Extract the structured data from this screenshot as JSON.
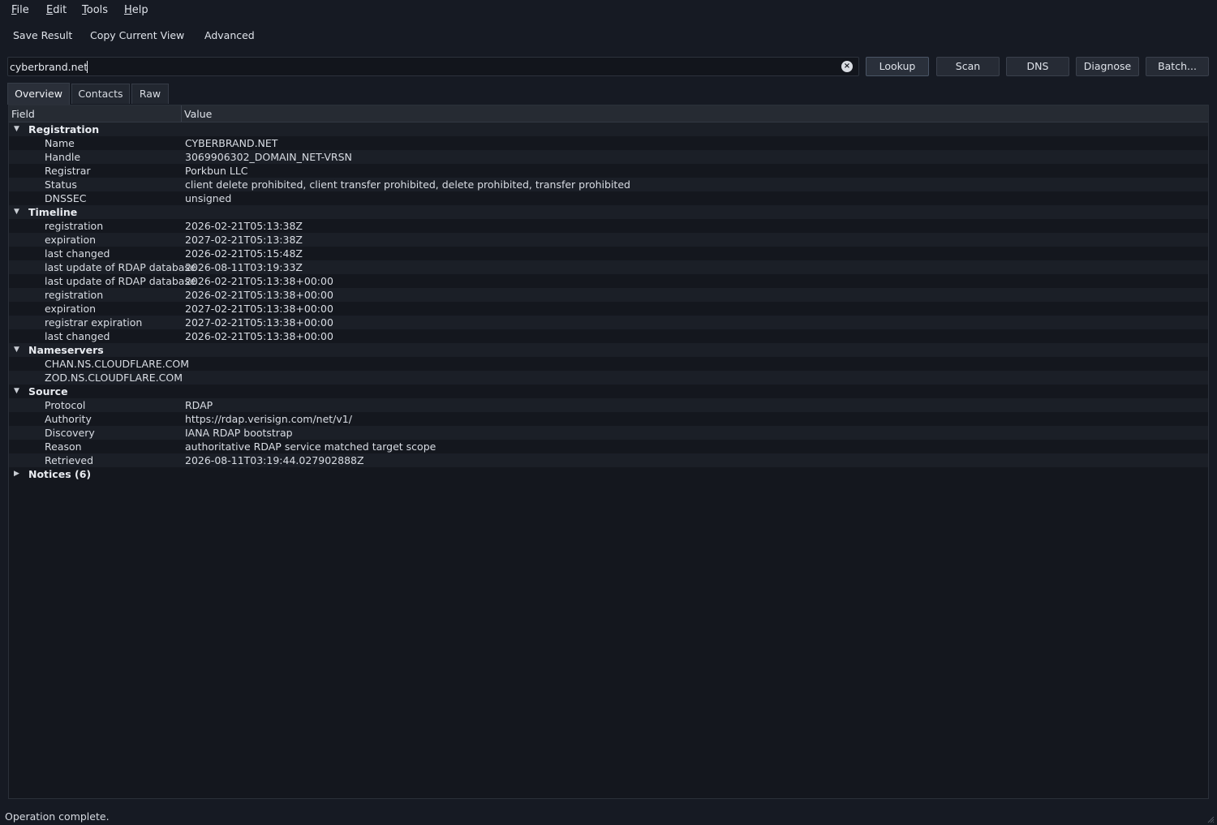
{
  "menubar": {
    "items": [
      {
        "label": "File",
        "mnemonic": "F",
        "rest": "ile"
      },
      {
        "label": "Edit",
        "mnemonic": "E",
        "rest": "dit"
      },
      {
        "label": "Tools",
        "mnemonic": "T",
        "rest": "ools"
      },
      {
        "label": "Help",
        "mnemonic": "H",
        "rest": "elp"
      }
    ]
  },
  "toolbar": {
    "save_result": "Save Result",
    "copy_current_view": "Copy Current View",
    "advanced": "Advanced"
  },
  "search": {
    "value": "cyberbrand.net",
    "clear_icon": "×"
  },
  "actions": {
    "lookup": "Lookup",
    "scan": "Scan",
    "dns": "DNS",
    "diagnose": "Diagnose",
    "batch": "Batch..."
  },
  "tabs": {
    "overview": "Overview",
    "contacts": "Contacts",
    "raw": "Raw"
  },
  "tree": {
    "header": {
      "field": "Field",
      "value": "Value"
    },
    "groups": {
      "registration": {
        "label": "Registration",
        "rows": [
          {
            "field": "Name",
            "value": "CYBERBRAND.NET"
          },
          {
            "field": "Handle",
            "value": "3069906302_DOMAIN_NET-VRSN"
          },
          {
            "field": "Registrar",
            "value": "Porkbun LLC"
          },
          {
            "field": "Status",
            "value": "client delete prohibited, client transfer prohibited, delete prohibited, transfer prohibited"
          },
          {
            "field": "DNSSEC",
            "value": "unsigned"
          }
        ]
      },
      "timeline": {
        "label": "Timeline",
        "rows": [
          {
            "field": "registration",
            "value": "2026-02-21T05:13:38Z"
          },
          {
            "field": "expiration",
            "value": "2027-02-21T05:13:38Z"
          },
          {
            "field": "last changed",
            "value": "2026-02-21T05:15:48Z"
          },
          {
            "field": "last update of RDAP database",
            "value": "2026-08-11T03:19:33Z"
          },
          {
            "field": "last update of RDAP database",
            "value": "2026-02-21T05:13:38+00:00"
          },
          {
            "field": "registration",
            "value": "2026-02-21T05:13:38+00:00"
          },
          {
            "field": "expiration",
            "value": "2027-02-21T05:13:38+00:00"
          },
          {
            "field": "registrar expiration",
            "value": "2027-02-21T05:13:38+00:00"
          },
          {
            "field": "last changed",
            "value": "2026-02-21T05:13:38+00:00"
          }
        ]
      },
      "nameservers": {
        "label": "Nameservers",
        "rows": [
          {
            "field": "CHAN.NS.CLOUDFLARE.COM",
            "value": ""
          },
          {
            "field": "ZOD.NS.CLOUDFLARE.COM",
            "value": ""
          }
        ]
      },
      "source": {
        "label": "Source",
        "rows": [
          {
            "field": "Protocol",
            "value": "RDAP"
          },
          {
            "field": "Authority",
            "value": "https://rdap.verisign.com/net/v1/"
          },
          {
            "field": "Discovery",
            "value": "IANA RDAP bootstrap"
          },
          {
            "field": "Reason",
            "value": "authoritative RDAP service matched target scope"
          },
          {
            "field": "Retrieved",
            "value": "2026-08-11T03:19:44.027902888Z"
          }
        ]
      },
      "notices": {
        "label": "Notices (6)"
      }
    }
  },
  "status": {
    "text": "Operation complete."
  },
  "icons": {
    "expanded": "chevron-down-icon",
    "collapsed": "chevron-right-icon",
    "clear": "clear-icon",
    "grip": "resize-grip-icon"
  },
  "colors": {
    "background": "#161a23",
    "tree_background": "#14171e",
    "alt_row": "#1b1f27",
    "text": "#d7dbe2"
  }
}
